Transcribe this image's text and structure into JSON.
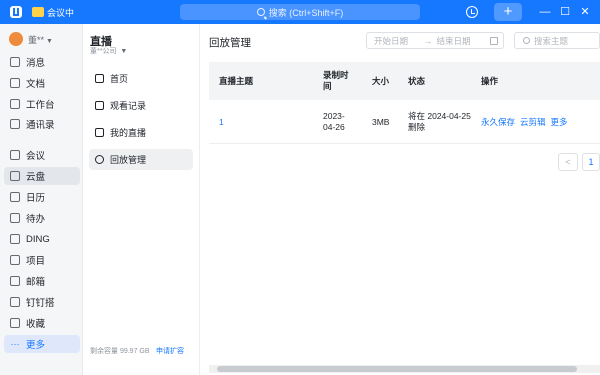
{
  "topbar": {
    "meeting_label": "会议中",
    "search_placeholder": "搜索 (Ctrl+Shift+F)",
    "window_controls": [
      "—",
      "☐",
      "✕"
    ],
    "plus": "+"
  },
  "profile": {
    "name": "董**"
  },
  "leftnav": {
    "items": [
      {
        "label": "消息",
        "icon": "message-icon"
      },
      {
        "label": "文档",
        "icon": "document-icon"
      },
      {
        "label": "工作台",
        "icon": "workbench-icon"
      },
      {
        "label": "通讯录",
        "icon": "contacts-icon"
      },
      {
        "label": "会议",
        "icon": "meeting-icon"
      },
      {
        "label": "云盘",
        "icon": "cloud-drive-icon"
      },
      {
        "label": "日历",
        "icon": "calendar-icon"
      },
      {
        "label": "待办",
        "icon": "todo-icon"
      },
      {
        "label": "DING",
        "icon": "ding-icon"
      },
      {
        "label": "项目",
        "icon": "project-icon"
      },
      {
        "label": "邮箱",
        "icon": "mail-icon"
      },
      {
        "label": "钉钉搭",
        "icon": "app-builder-icon"
      },
      {
        "label": "收藏",
        "icon": "favorites-icon"
      },
      {
        "label": "更多",
        "icon": "more-icon"
      }
    ]
  },
  "sidebar": {
    "title": "直播",
    "org": "董**公司",
    "items": [
      {
        "label": "首页",
        "icon": "home-icon"
      },
      {
        "label": "观看记录",
        "icon": "watch-history-icon"
      },
      {
        "label": "我的直播",
        "icon": "my-live-icon"
      },
      {
        "label": "回放管理",
        "icon": "replay-icon"
      }
    ],
    "storage_text": "剩余容量 99.97 GB",
    "expand_label": "申请扩容"
  },
  "main": {
    "title": "回放管理",
    "start_date_placeholder": "开始日期",
    "end_date_placeholder": "结束日期",
    "date_arrow": "→",
    "search_placeholder": "搜索主题",
    "columns": [
      "直播主题",
      "录制时间",
      "大小",
      "状态",
      "操作"
    ],
    "rows": [
      {
        "topic": "1",
        "record_time": "2023-04-26",
        "size": "3MB",
        "status": "将在 2024-04-25 删除",
        "actions": [
          "永久保存",
          "云剪辑",
          "更多"
        ]
      }
    ],
    "pager": {
      "prev": "<",
      "current": "1"
    }
  },
  "colors": {
    "accent": "#1677ff",
    "topbar": "#1677ff",
    "nav_bg": "#f5f6f7"
  }
}
